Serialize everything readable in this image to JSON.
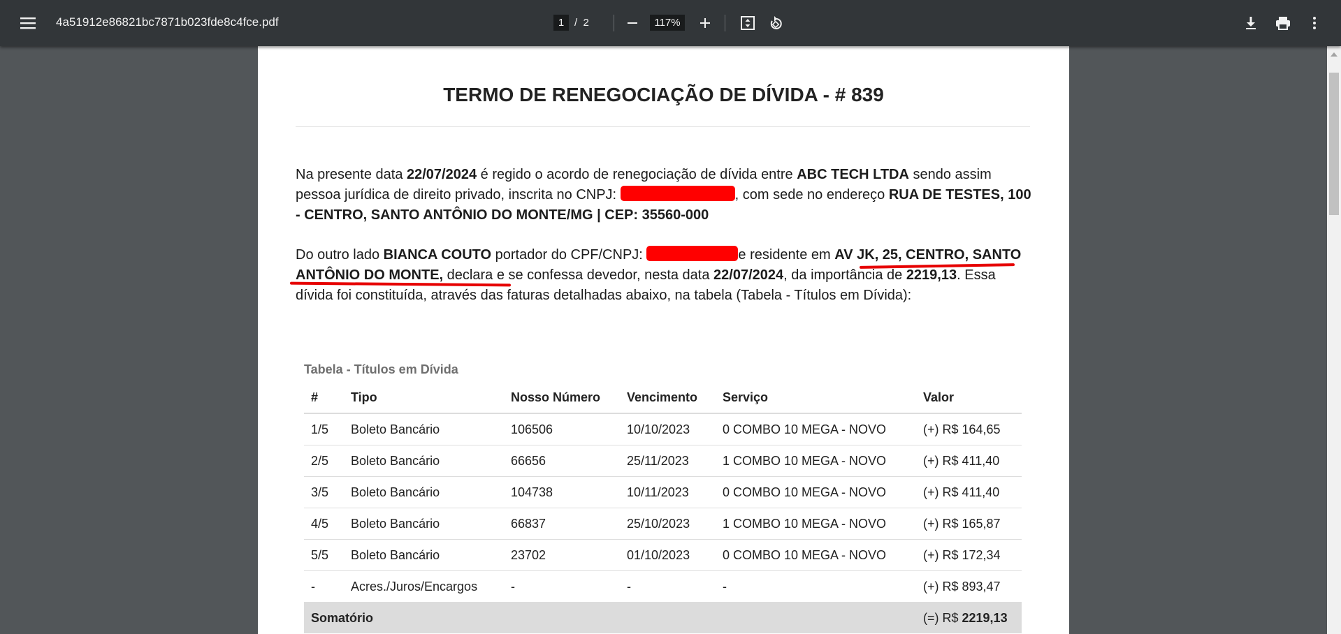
{
  "toolbar": {
    "file_name": "4a51912e86821bc7871b023fde8c4fce.pdf",
    "current_page": "1",
    "page_sep": "/",
    "total_pages": "2",
    "zoom": "117%"
  },
  "document": {
    "title": "TERMO DE RENEGOCIAÇÃO DE DÍVIDA - # 839",
    "p1": {
      "t1": "Na presente data ",
      "date": "22/07/2024",
      "t2": " é regido o acordo de renegociação de dívida entre ",
      "company": "ABC TECH LTDA",
      "t3": " sendo assim pessoa jurídica de direito privado, inscrita no CNPJ: ",
      "t4": ", com sede no endereço ",
      "address": "RUA DE TESTES, 100 - CENTRO, SANTO ANTÔNIO DO MONTE/MG | CEP: 35560-000"
    },
    "p2": {
      "t1": "Do outro lado ",
      "debtor": "BIANCA COUTO",
      "t2": " portador do CPF/CNPJ: ",
      "t3": "e residente em ",
      "address": "AV JK, 25, CENTRO, SANTO ANTÔNIO DO MONTE,",
      "t4": " declara e se confessa devedor, nesta data ",
      "date": "22/07/2024",
      "t5": ", da importância de ",
      "amount": "2219,13",
      "t6": ". Essa dívida foi constituída, através das faturas detalhadas abaixo, na tabela (Tabela - Títulos em Dívida):"
    },
    "table": {
      "caption": "Tabela - Títulos em Dívida",
      "headers": [
        "#",
        "Tipo",
        "Nosso Número",
        "Vencimento",
        "Serviço",
        "Valor"
      ],
      "rows": [
        [
          "1/5",
          "Boleto Bancário",
          "106506",
          "10/10/2023",
          "0 COMBO 10 MEGA - NOVO",
          "(+) R$ 164,65"
        ],
        [
          "2/5",
          "Boleto Bancário",
          "66656",
          "25/11/2023",
          "1 COMBO 10 MEGA - NOVO",
          "(+) R$ 411,40"
        ],
        [
          "3/5",
          "Boleto Bancário",
          "104738",
          "10/11/2023",
          "0 COMBO 10 MEGA - NOVO",
          "(+) R$ 411,40"
        ],
        [
          "4/5",
          "Boleto Bancário",
          "66837",
          "25/10/2023",
          "1 COMBO 10 MEGA - NOVO",
          "(+) R$ 165,87"
        ],
        [
          "5/5",
          "Boleto Bancário",
          "23702",
          "01/10/2023",
          "0 COMBO 10 MEGA - NOVO",
          "(+) R$ 172,34"
        ],
        [
          "-",
          "Acres./Juros/Encargos",
          "-",
          "-",
          "-",
          "(+) R$ 893,47"
        ]
      ],
      "sum": {
        "label": "Somatório",
        "prefix": "(=) R$ ",
        "value": "2219,13"
      }
    }
  },
  "colors": {
    "toolbar_bg": "#323639",
    "viewer_bg": "#525659",
    "redaction": "#ff0000",
    "underline": "#e60000"
  },
  "icons": [
    "menu-icon",
    "zoom-out-icon",
    "zoom-in-icon",
    "fit-page-icon",
    "rotate-icon",
    "download-icon",
    "print-icon",
    "more-vert-icon"
  ]
}
